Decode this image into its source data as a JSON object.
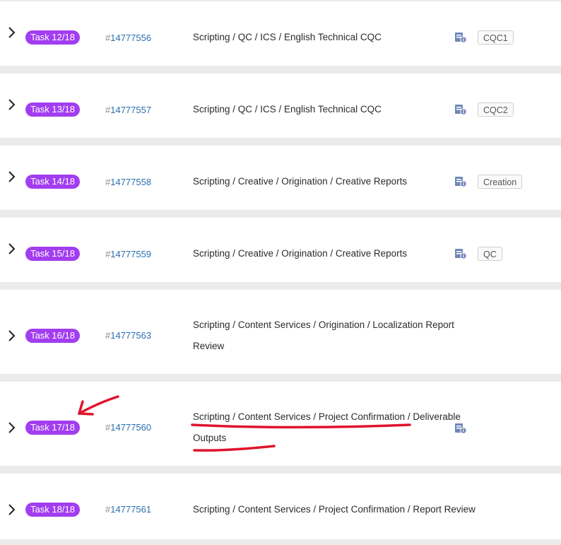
{
  "tasks": [
    {
      "badge": "Task 12/18",
      "hash": "#",
      "id": "14777556",
      "path": "Scripting / QC / ICS / English Technical CQC",
      "tag": "CQC1"
    },
    {
      "badge": "Task 13/18",
      "hash": "#",
      "id": "14777557",
      "path": "Scripting / QC / ICS / English Technical CQC",
      "tag": "CQC2"
    },
    {
      "badge": "Task 14/18",
      "hash": "#",
      "id": "14777558",
      "path": "Scripting / Creative / Origination / Creative Reports",
      "tag": "Creation"
    },
    {
      "badge": "Task 15/18",
      "hash": "#",
      "id": "14777559",
      "path": "Scripting / Creative / Origination / Creative Reports",
      "tag": "QC"
    },
    {
      "badge": "Task 16/18",
      "hash": "#",
      "id": "14777563",
      "path": "Scripting / Content Services / Origination / Localization Report Review"
    },
    {
      "badge": "Task 17/18",
      "hash": "#",
      "id": "14777560",
      "path": "Scripting / Content Services / Project Confirmation / Deliverable Outputs"
    },
    {
      "badge": "Task 18/18",
      "hash": "#",
      "id": "14777561",
      "path": "Scripting / Content Services / Project Confirmation / Report Review"
    }
  ],
  "colors": {
    "badge": "#a23df0",
    "task_id_link": "#2a6fb0",
    "annotation": "#e0142c",
    "doc_icon": "#6f87b8",
    "row_separator": "#ebebeb"
  },
  "icons": {
    "expand": "chevron-right-icon",
    "document": "document-info-icon",
    "annotation": "red-arrow-annotation"
  }
}
